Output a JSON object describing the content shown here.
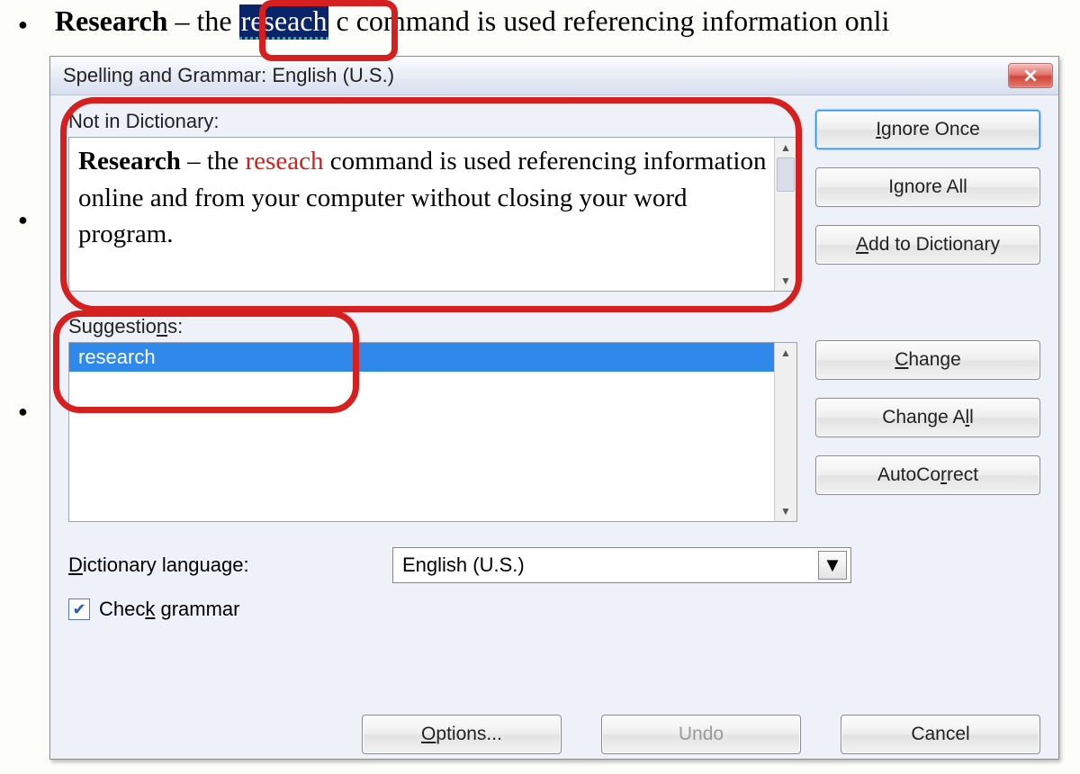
{
  "document": {
    "line1_bold": "Research",
    "line1_before": " – th",
    "line1_marked": "reseach",
    "line1_after": " command is used referencing information onli",
    "line1_gap": "e ",
    "line1_gap2": " c"
  },
  "dialog": {
    "title": "Spelling and Grammar: English (U.S.)",
    "not_in_dict_label": "Not in Dictionary:",
    "sentence": {
      "bold": "Research",
      "before": " – the ",
      "error": "reseach",
      "after": " command is used referencing information online and from your computer without closing your word program."
    },
    "suggestions_label": "Suggestions:",
    "suggestions": [
      "research"
    ],
    "buttons": {
      "ignore_once": "Ignore Once",
      "ignore_all": "Ignore All",
      "add": "Add to Dictionary",
      "change": "Change",
      "change_all": "Change All",
      "autocorrect": "AutoCorrect",
      "options": "Options...",
      "undo": "Undo",
      "cancel": "Cancel"
    },
    "language_label": "Dictionary language:",
    "language_value": "English (U.S.)",
    "check_grammar": "Check grammar"
  }
}
